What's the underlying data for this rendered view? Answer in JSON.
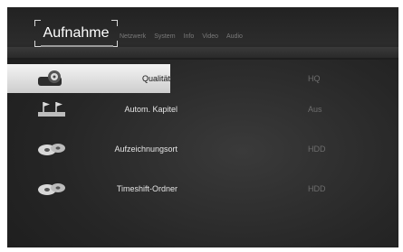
{
  "header": {
    "active_tab": "Aufnahme",
    "tabs": [
      "Netzwerk",
      "System",
      "Info",
      "Video",
      "Audio"
    ]
  },
  "menu": {
    "items": [
      {
        "label": "Qualität",
        "value": "HQ",
        "icon": "recorder-icon",
        "selected": true
      },
      {
        "label": "Autom. Kapitel",
        "value": "Aus",
        "icon": "chapter-flags-icon",
        "selected": false
      },
      {
        "label": "Aufzeichnungsort",
        "value": "HDD",
        "icon": "disc-icon",
        "selected": false
      },
      {
        "label": "Timeshift-Ordner",
        "value": "HDD",
        "icon": "disc-icon",
        "selected": false
      }
    ]
  },
  "colors": {
    "background": "#262626",
    "selected_bar": "#e6e6e6",
    "label_text": "#e6e6e6",
    "value_text": "#6e6e6e"
  }
}
